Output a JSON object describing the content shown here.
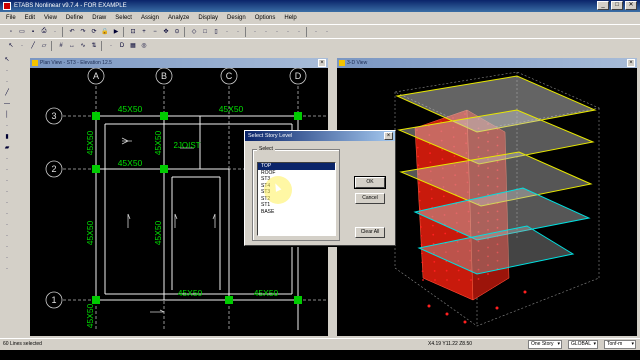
{
  "app": {
    "title": "ETABS Nonlinear v9.7.4 - FOR EXAMPLE",
    "window_controls": [
      "_",
      "□",
      "✕"
    ]
  },
  "menu": [
    "File",
    "Edit",
    "View",
    "Define",
    "Draw",
    "Select",
    "Assign",
    "Analyze",
    "Display",
    "Design",
    "Options",
    "Help"
  ],
  "toolbar1_icons": [
    "new-icon",
    "open-icon",
    "save-icon",
    "print-icon",
    "print-preview-icon",
    "undo-icon",
    "redo-icon",
    "refresh-icon",
    "lock-icon",
    "run-icon",
    "rubber-zoom-icon",
    "zoom-in-icon",
    "zoom-out-icon",
    "pan-icon",
    "restore-view-icon",
    "3d-view-icon",
    "plan-view-icon",
    "elevation-view-icon",
    "perspective-icon",
    "move-up-icon",
    "move-down-icon",
    "object-shrink-icon",
    "set-display-icon",
    "select-all-icon",
    "previous-select-icon",
    "clear-selection-icon",
    "intersect-select-icon"
  ],
  "toolbar1": {
    "view_3d": "3-d",
    "view_plan": "xy",
    "view_elev": "xz"
  },
  "toolbar2_icons": [
    "pointer-icon",
    "reshape-icon",
    "draw-line-icon",
    "draw-area-icon",
    "draw-grid-icon",
    "dimension-icon",
    "show-deformed-icon",
    "show-forces-icon",
    "show-stress-icon",
    "design-icon",
    "display-table-icon",
    "snap-icon"
  ],
  "left_toolbar_icons": [
    "select-pointer-icon",
    "reshape-icon",
    "draw-point-icon",
    "draw-line-icon",
    "draw-beam-icon",
    "draw-column-icon",
    "draw-brace-icon",
    "draw-wall-icon",
    "draw-floor-icon",
    "draw-opening-icon",
    "draw-dimension-icon",
    "snap-points-icon",
    "snap-ends-icon",
    "snap-intersections-icon",
    "snap-perpendicular-icon",
    "snap-lines-icon",
    "snap-grid-icon",
    "all-stories-icon",
    "similar-stories-icon",
    "one-story-icon"
  ],
  "plan_window": {
    "title": "Plan View - ST3 - Elevation 12.5",
    "grid_cols": [
      "A",
      "B",
      "C",
      "D"
    ],
    "grid_rows": [
      "3",
      "2",
      "1"
    ],
    "beam_labels": [
      "45X50",
      "45X50",
      "45X50",
      "45X50",
      "45X50",
      "45X50",
      "45X50"
    ],
    "joist_label": "2JOIST",
    "colors": {
      "grid": "#b8b8b8",
      "beam": "#f0f0f0",
      "column": "#00cc00",
      "label": "#00e000"
    }
  },
  "view3d_window": {
    "title": "3-D View",
    "colors": {
      "wall": "#d02010",
      "slab_fill": "#bfbfbf",
      "slab_edge_yellow": "#e8e800",
      "slab_edge_cyan": "#00e0e0",
      "grid": "#8a8a8a",
      "point": "#ff2020"
    }
  },
  "dialog": {
    "title": "Select Story Level",
    "group_label": "Select",
    "stories": [
      "TOP",
      "ROOF",
      "ST3",
      "ST4",
      "ST3",
      "ST2",
      "ST1",
      "BASE"
    ],
    "selected_index": 0,
    "ok_label": "OK",
    "cancel_label": "Cancel",
    "clear_all_label": "Clear All"
  },
  "status": {
    "message": "60 Lines selected",
    "coords": "X4.19 Y11.22 Z8.50",
    "story_mode": "One Story",
    "coord_system": "GLOBAL",
    "units": "Tonf-m"
  }
}
